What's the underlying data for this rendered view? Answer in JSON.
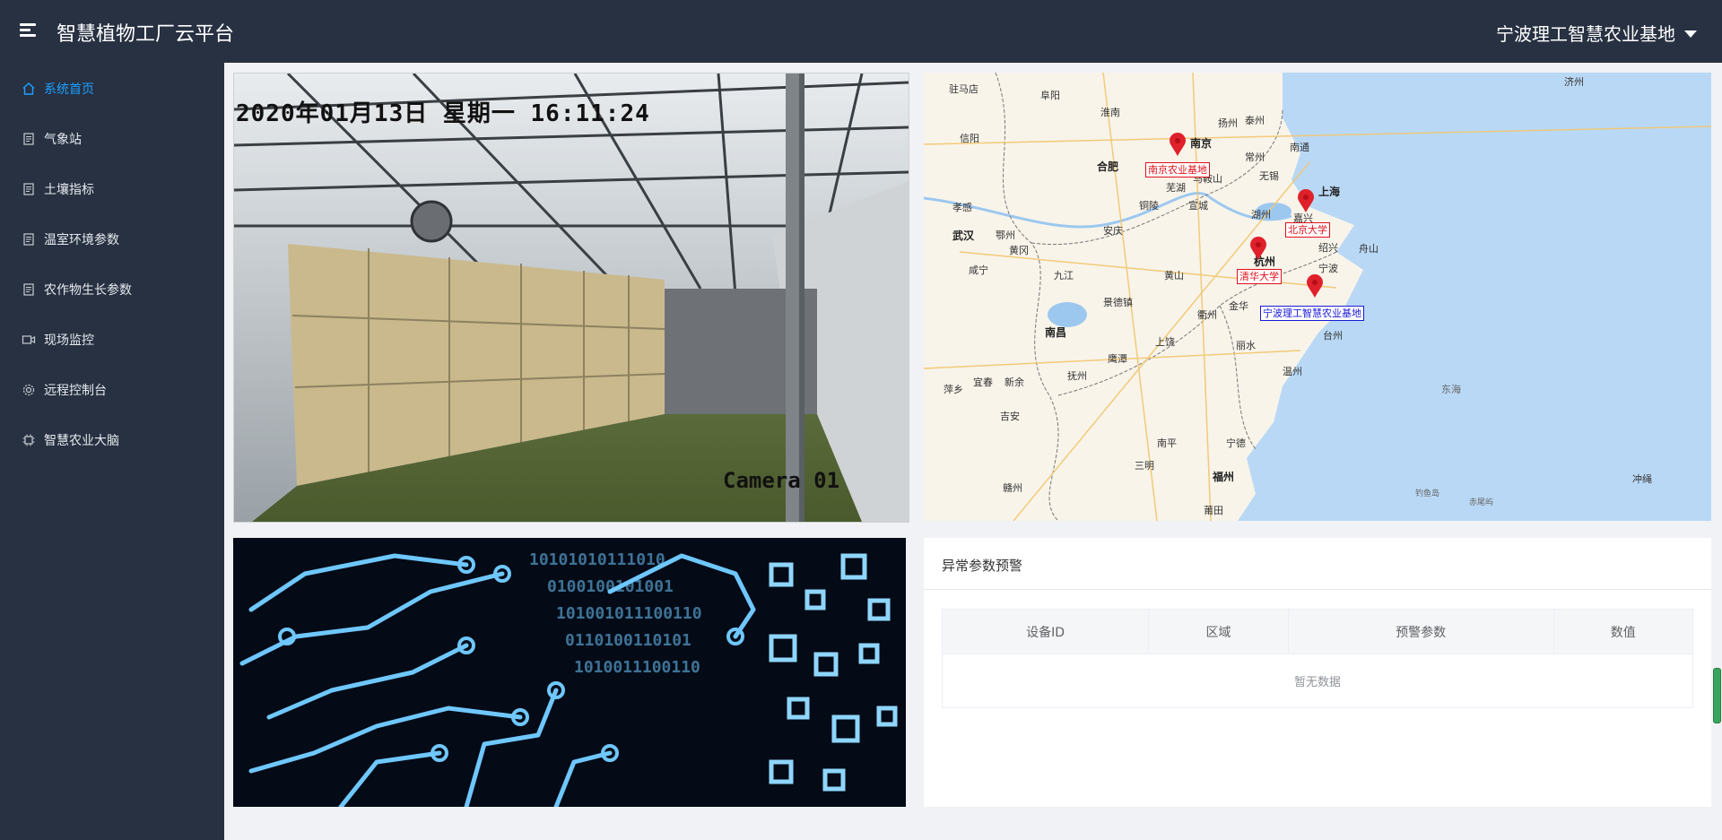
{
  "header": {
    "title": "智慧植物工厂云平台",
    "site": "宁波理工智慧农业基地"
  },
  "sidebar": {
    "items": [
      {
        "label": "系统首页",
        "icon": "home-icon",
        "active": true
      },
      {
        "label": "气象站",
        "icon": "document-icon"
      },
      {
        "label": "土壤指标",
        "icon": "document-icon"
      },
      {
        "label": "温室环境参数",
        "icon": "document-icon"
      },
      {
        "label": "农作物生长参数",
        "icon": "document-icon"
      },
      {
        "label": "现场监控",
        "icon": "video-icon"
      },
      {
        "label": "远程控制台",
        "icon": "gear-icon"
      },
      {
        "label": "智慧农业大脑",
        "icon": "chip-icon"
      }
    ]
  },
  "camera": {
    "timestamp": "2020年01月13日  星期一  16:11:24",
    "label": "Camera 01"
  },
  "map": {
    "cities": [
      "驻马店",
      "阜阳",
      "淮南",
      "信阳",
      "合肥",
      "南京",
      "扬州",
      "泰州",
      "南通",
      "常州",
      "无锡",
      "上海",
      "湖州",
      "嘉兴",
      "芜湖",
      "马鞍山",
      "铜陵",
      "宣城",
      "安庆",
      "孝感",
      "武汉",
      "鄂州",
      "黄冈",
      "咸宁",
      "九江",
      "黄山",
      "杭州",
      "绍兴",
      "宁波",
      "舟山",
      "景德镇",
      "衢州",
      "金华",
      "南昌",
      "上饶",
      "丽水",
      "台州",
      "鹰潭",
      "抚州",
      "温州",
      "宜春",
      "新余",
      "萍乡",
      "吉安",
      "南平",
      "宁德",
      "三明",
      "福州",
      "赣州",
      "莆田",
      "东海",
      "济州",
      "冲绳",
      "钓鱼岛",
      "赤尾屿"
    ],
    "markers": [
      {
        "label": "南京农业基地",
        "style": "red"
      },
      {
        "label": "北京大学",
        "style": "red"
      },
      {
        "label": "清华大学",
        "style": "red"
      },
      {
        "label": "宁波理工智慧农业基地",
        "style": "blue"
      }
    ]
  },
  "alerts": {
    "title": "异常参数预警",
    "columns": [
      "设备ID",
      "区域",
      "预警参数",
      "数值"
    ],
    "empty_text": "暂无数据"
  }
}
